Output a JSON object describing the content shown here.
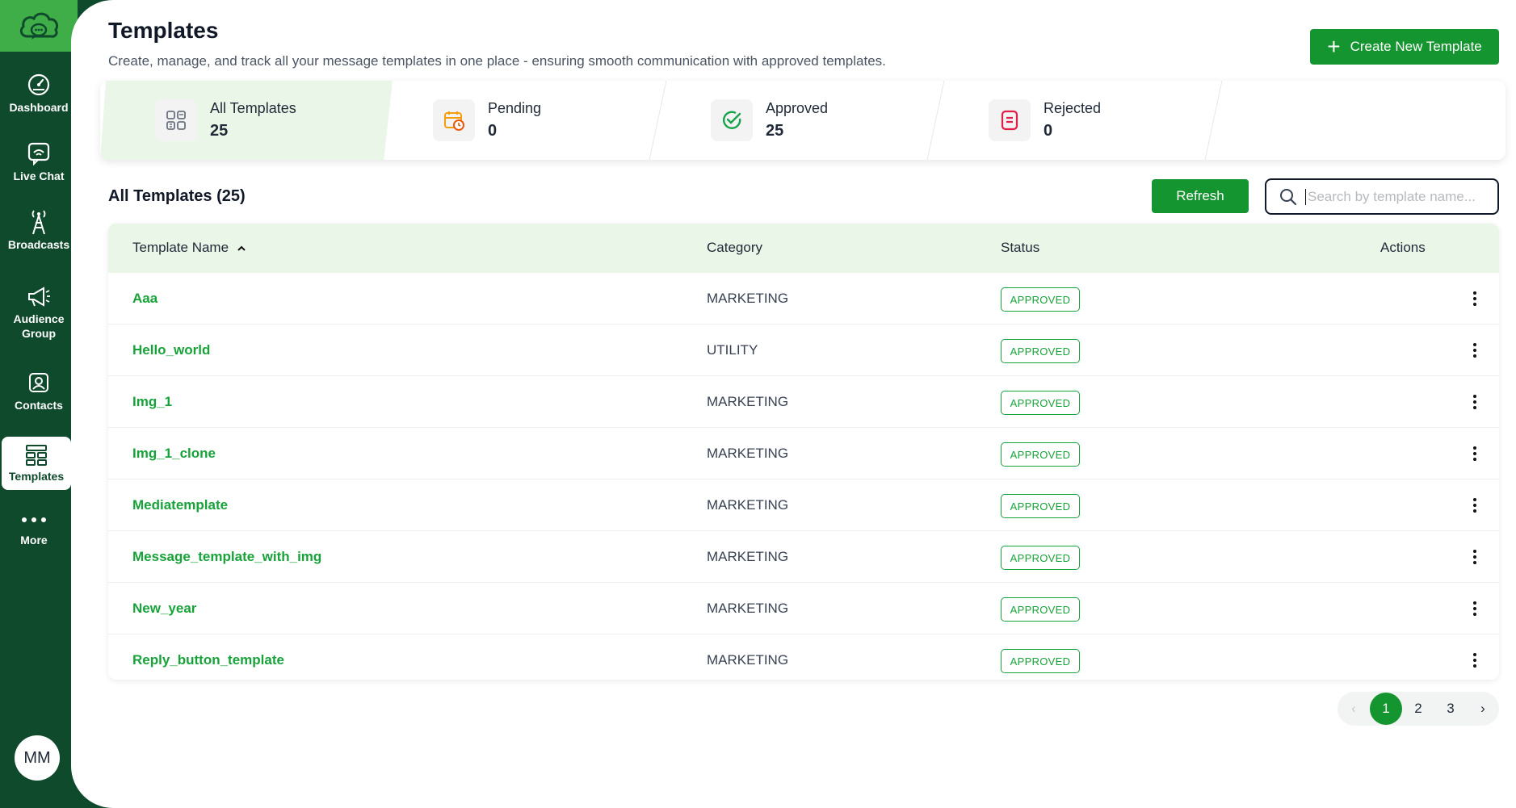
{
  "sidebar": {
    "items": [
      {
        "label": "Dashboard",
        "icon": "gauge-icon"
      },
      {
        "label": "Live Chat",
        "icon": "chat-icon"
      },
      {
        "label": "Broadcasts",
        "icon": "antenna-icon"
      },
      {
        "label": "Audience\nGroup",
        "label1": "Audience",
        "label2": "Group",
        "icon": "megaphone-icon"
      },
      {
        "label": "Contacts",
        "icon": "contact-icon"
      },
      {
        "label": "Templates",
        "icon": "templates-icon"
      },
      {
        "label": "More",
        "icon": "dots-icon"
      }
    ],
    "active": "Templates",
    "avatar": "MM"
  },
  "header": {
    "title": "Templates",
    "subtitle": "Create, manage, and track all your message templates in one place - ensuring smooth communication with approved templates.",
    "create_label": "Create New Template"
  },
  "stats": [
    {
      "label": "All Templates",
      "value": "25",
      "icon": "grid-icon"
    },
    {
      "label": "Pending",
      "value": "0",
      "icon": "calendar-clock-icon"
    },
    {
      "label": "Approved",
      "value": "25",
      "icon": "check-circle-icon"
    },
    {
      "label": "Rejected",
      "value": "0",
      "icon": "rejected-doc-icon"
    }
  ],
  "list": {
    "title": "All Templates (25)",
    "refresh_label": "Refresh",
    "search_placeholder": "Search by template name..."
  },
  "table": {
    "columns": [
      "Template Name",
      "Category",
      "Status",
      "Actions"
    ],
    "rows": [
      {
        "name": "Aaa",
        "category": "MARKETING",
        "status": "APPROVED"
      },
      {
        "name": "Hello_world",
        "category": "UTILITY",
        "status": "APPROVED"
      },
      {
        "name": "Img_1",
        "category": "MARKETING",
        "status": "APPROVED"
      },
      {
        "name": "Img_1_clone",
        "category": "MARKETING",
        "status": "APPROVED"
      },
      {
        "name": "Mediatemplate",
        "category": "MARKETING",
        "status": "APPROVED"
      },
      {
        "name": "Message_template_with_img",
        "category": "MARKETING",
        "status": "APPROVED"
      },
      {
        "name": "New_year",
        "category": "MARKETING",
        "status": "APPROVED"
      },
      {
        "name": "Reply_button_template",
        "category": "MARKETING",
        "status": "APPROVED"
      }
    ]
  },
  "pagination": {
    "prev": "‹",
    "pages": [
      "1",
      "2",
      "3"
    ],
    "current": "1",
    "next": "›"
  },
  "colors": {
    "primary": "#15952f",
    "sidebar": "#0f4a2c",
    "logo_bg": "#3fae49",
    "header_tint": "#eaf6e7"
  }
}
